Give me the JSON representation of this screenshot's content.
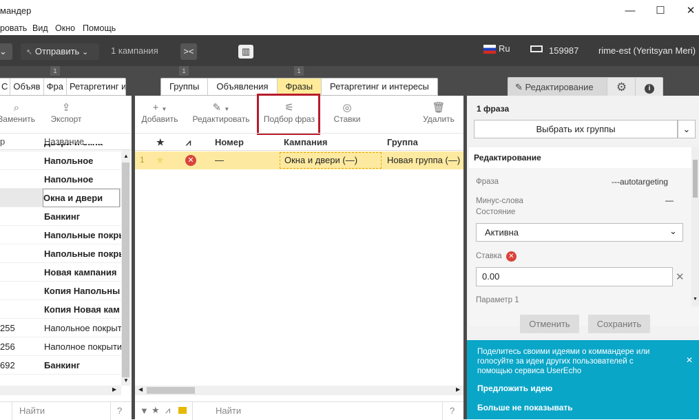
{
  "window": {
    "title": "мандер",
    "minimize": "—",
    "maximize": "☐",
    "close": "✕"
  },
  "menu": [
    "ровать",
    "Вид",
    "Окно",
    "Помощь"
  ],
  "toolbar": {
    "send_label": "Отправить",
    "campaigns_count": "1 кампания",
    "lang": "Ru",
    "balance": "159987",
    "user": "rime-est (Yeritsyan Meri)"
  },
  "badges": [
    "1",
    "1",
    "1"
  ],
  "left_panel": {
    "tabs": [
      "С",
      "Объяв",
      "Фра",
      "Ретаргетинг и"
    ],
    "buttons": [
      {
        "label": "Заменить",
        "icon": "search-icon"
      },
      {
        "label": "Экспорт",
        "icon": "export-icon"
      }
    ],
    "columns": [
      "р",
      "Название"
    ],
    "rows": [
      {
        "id": "",
        "name": "Двери и окна",
        "bold": true
      },
      {
        "id": "",
        "name": "Напольное",
        "bold": true
      },
      {
        "id": "",
        "name": "Напольное",
        "bold": true
      },
      {
        "id": "",
        "name": "Окна и двери",
        "bold": true,
        "selected": true
      },
      {
        "id": "",
        "name": "Банкинг",
        "bold": true
      },
      {
        "id": "",
        "name": "Напольные покры",
        "bold": true
      },
      {
        "id": "",
        "name": "Напольные покры",
        "bold": true
      },
      {
        "id": "",
        "name": "Новая кампания",
        "bold": true
      },
      {
        "id": "",
        "name": "Копия Напольны",
        "bold": true
      },
      {
        "id": "",
        "name": "Копия Новая кам",
        "bold": true
      },
      {
        "id": "255",
        "name": "Напольное покрыт",
        "bold": false
      },
      {
        "id": "256",
        "name": "Наполное покрыти",
        "bold": false
      },
      {
        "id": "692",
        "name": "Банкинг",
        "bold": true
      }
    ],
    "search_placeholder": "Найти",
    "help": "?"
  },
  "center_panel": {
    "tabs": [
      "Группы",
      "Объявления",
      "Фразы",
      "Ретаргетинг и интересы"
    ],
    "active_tab": "Фразы",
    "buttons": [
      {
        "label": "Добавить",
        "icon": "plus-icon"
      },
      {
        "label": "Редактировать",
        "icon": "pencil-icon"
      },
      {
        "label": "Подбор фраз",
        "icon": "phrase-tree-icon"
      },
      {
        "label": "Ставки",
        "icon": "bids-icon"
      },
      {
        "label": "Удалить",
        "icon": "trash-icon"
      }
    ],
    "columns": [
      "★",
      "",
      "Номер",
      "Кампания",
      "Группа"
    ],
    "row": {
      "index": "1",
      "number": "—",
      "campaign": "Окна и двери (—)",
      "group": "Новая группа (—)"
    },
    "search_placeholder": "Найти",
    "help": "?"
  },
  "right_panel": {
    "edit_tab": "Редактирование",
    "count_title": "1 фраза",
    "group_select": "Выбрать их группы",
    "section_title": "Редактирование",
    "fields": {
      "phrase_label": "Фраза",
      "phrase_value": "---autotargeting",
      "minus_label": "Минус-слова",
      "minus_value": "—",
      "state_label": "Состояние",
      "state_value": "Активна",
      "bid_label": "Ставка",
      "bid_value": "0.00",
      "param_label": "Параметр 1"
    },
    "cancel": "Отменить",
    "save": "Сохранить",
    "notice": {
      "text": "Поделитесь своими идеями о коммандере или голосуйте за идеи других пользователей с помощью сервиса UserEcho",
      "suggest": "Предложить идею",
      "hide": "Больше не показывать"
    }
  },
  "colors": {
    "accent_yellow": "#ffeb99",
    "highlight_red": "#b71c2b",
    "notice_bg": "#0aa6c8",
    "dark": "#3c3c3c"
  }
}
